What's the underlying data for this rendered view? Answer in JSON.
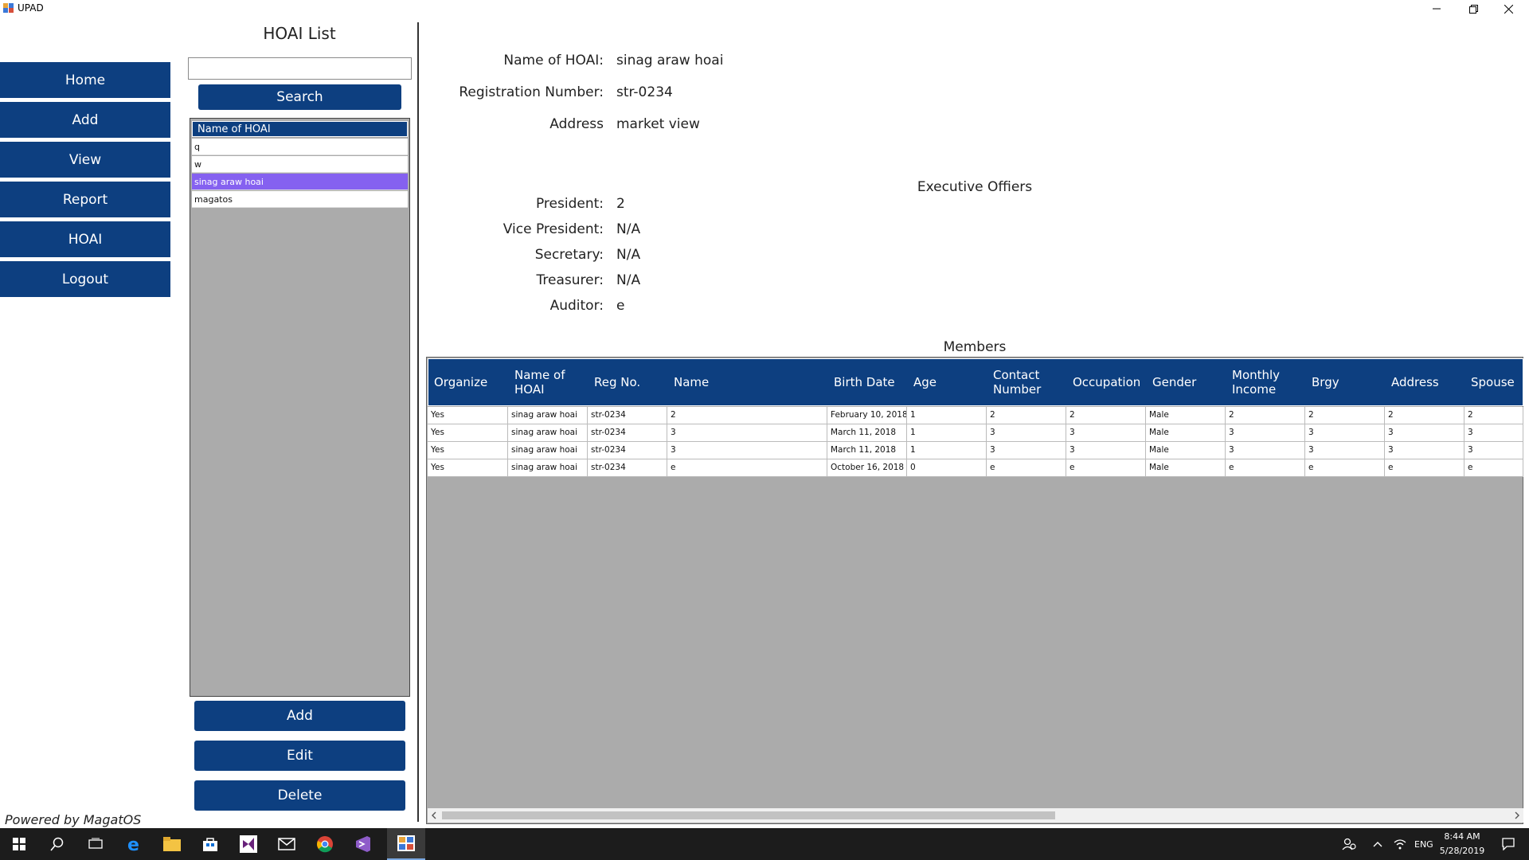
{
  "window": {
    "title": "UPAD"
  },
  "nav": {
    "items": [
      {
        "label": "Home"
      },
      {
        "label": "Add"
      },
      {
        "label": "View"
      },
      {
        "label": "Report"
      },
      {
        "label": "HOAI"
      },
      {
        "label": "Logout"
      }
    ]
  },
  "list_panel": {
    "title": "HOAI List",
    "search_value": "",
    "search_label": "Search",
    "column_header": "Name of HOAI",
    "items": [
      "q",
      "w",
      "sinag araw hoai",
      "magatos"
    ],
    "selected": "sinag araw hoai",
    "add_label": "Add",
    "edit_label": "Edit",
    "delete_label": "Delete"
  },
  "details": {
    "name_label": "Name of HOAI:",
    "name_value": "sinag araw hoai",
    "reg_label": "Registration Number:",
    "reg_value": "str-0234",
    "address_label": "Address",
    "address_value": "market view"
  },
  "officers": {
    "title": "Executive Offiers",
    "president_label": "President:",
    "president_value": "2",
    "vice_label": "Vice President:",
    "vice_value": "N/A",
    "secretary_label": "Secretary:",
    "secretary_value": "N/A",
    "treasurer_label": "Treasurer:",
    "treasurer_value": "N/A",
    "auditor_label": "Auditor:",
    "auditor_value": "e"
  },
  "members": {
    "title": "Members",
    "columns": [
      "Organize",
      "Name of HOAI",
      "Reg No.",
      "Name",
      "Birth Date",
      "Age",
      "Contact Number",
      "Occupation",
      "Gender",
      "Monthly Income",
      "Brgy",
      "Address",
      "Spouse"
    ],
    "rows": [
      [
        "Yes",
        "sinag araw hoai",
        "str-0234",
        "2",
        "February 10, 2018",
        "1",
        "2",
        "2",
        "Male",
        "2",
        "2",
        "2",
        "2"
      ],
      [
        "Yes",
        "sinag araw hoai",
        "str-0234",
        "3",
        "March 11, 2018",
        "1",
        "3",
        "3",
        "Male",
        "3",
        "3",
        "3",
        "3"
      ],
      [
        "Yes",
        "sinag araw hoai",
        "str-0234",
        "3",
        "March 11, 2018",
        "1",
        "3",
        "3",
        "Male",
        "3",
        "3",
        "3",
        "3"
      ],
      [
        "Yes",
        "sinag araw hoai",
        "str-0234",
        "e",
        "October 16, 2018",
        "0",
        "e",
        "e",
        "Male",
        "e",
        "e",
        "e",
        "e"
      ]
    ]
  },
  "footer": {
    "powered": "Powered by MagatOS"
  },
  "taskbar": {
    "lang": "ENG",
    "time": "8:44 AM",
    "date": "5/28/2019"
  },
  "colors": {
    "accent": "#0d3f80",
    "selection": "#8561f0",
    "grid_bg": "#ababab"
  }
}
